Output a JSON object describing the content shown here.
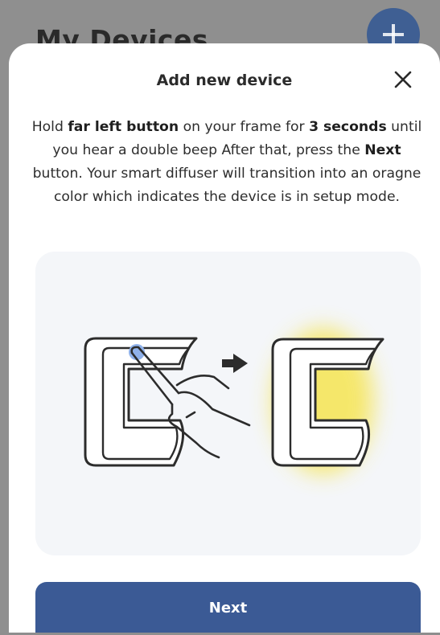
{
  "background": {
    "page_title": "My Devices"
  },
  "dialog": {
    "title": "Add new device",
    "instructions": {
      "t1": "Hold ",
      "b1": "far left button",
      "t2": " on your frame for ",
      "b2": "3 seconds",
      "t3": " until you hear a double beep After that, press the ",
      "b3": "Next",
      "t4": " button. Your smart diffuser will transition into an oragne color which indicates the device is in setup mode."
    },
    "next_label": "Next"
  },
  "colors": {
    "primary": "#3b5a95",
    "glow": "#f6e23a",
    "touch_dot": "#8fb1ea"
  },
  "icons": {
    "close": "close-icon",
    "arrow": "arrow-right-icon",
    "add": "plus-icon"
  }
}
